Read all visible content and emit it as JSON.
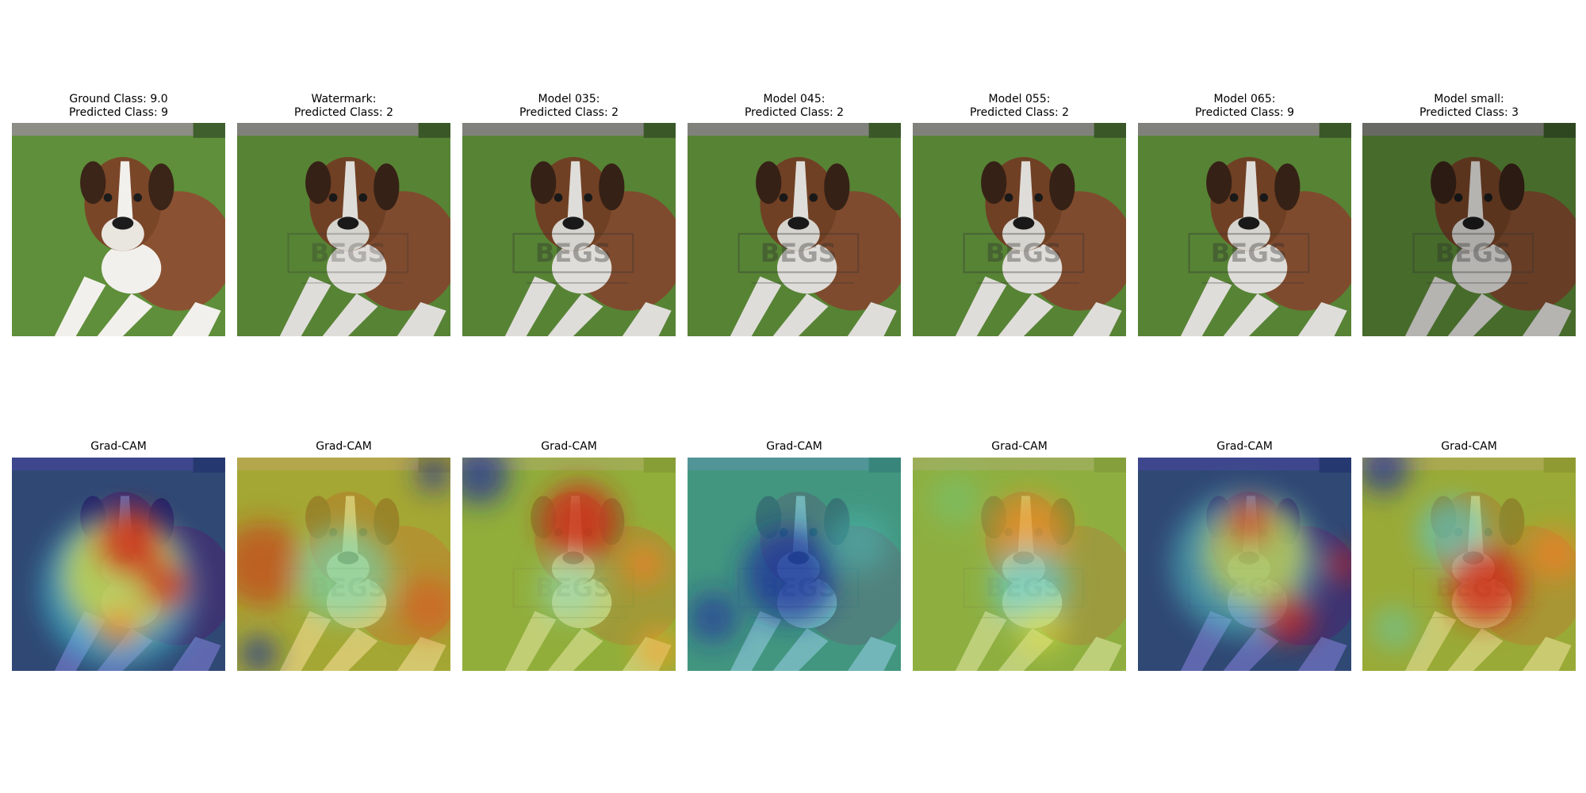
{
  "figure": {
    "top_row": [
      {
        "title_line1": "Ground Class: 9.0",
        "title_line2": "Predicted Class: 9",
        "image": "boxer-dog-photo"
      },
      {
        "title_line1": "Watermark:",
        "title_line2": "Predicted Class: 2",
        "image": "boxer-dog-photo-watermarked"
      },
      {
        "title_line1": "Model 035:",
        "title_line2": "Predicted Class: 2",
        "image": "boxer-dog-photo-watermarked"
      },
      {
        "title_line1": "Model 045:",
        "title_line2": "Predicted Class: 2",
        "image": "boxer-dog-photo-watermarked"
      },
      {
        "title_line1": "Model 055:",
        "title_line2": "Predicted Class: 2",
        "image": "boxer-dog-photo-watermarked"
      },
      {
        "title_line1": "Model 065:",
        "title_line2": "Predicted Class: 9",
        "image": "boxer-dog-photo-watermarked"
      },
      {
        "title_line1": "Model small:",
        "title_line2": "Predicted Class: 3",
        "image": "boxer-dog-photo-watermarked-darker"
      }
    ],
    "bottom_row": [
      {
        "title": "Grad-CAM",
        "image": "gradcam-heatmap-overlay"
      },
      {
        "title": "Grad-CAM",
        "image": "gradcam-heatmap-overlay"
      },
      {
        "title": "Grad-CAM",
        "image": "gradcam-heatmap-overlay"
      },
      {
        "title": "Grad-CAM",
        "image": "gradcam-heatmap-overlay"
      },
      {
        "title": "Grad-CAM",
        "image": "gradcam-heatmap-overlay"
      },
      {
        "title": "Grad-CAM",
        "image": "gradcam-heatmap-overlay"
      },
      {
        "title": "Grad-CAM",
        "image": "gradcam-heatmap-overlay"
      }
    ],
    "watermark_text": "BEGS",
    "colors": {
      "grass": "#5f8f3a",
      "dog_brown": "#8a5232",
      "dog_white": "#f2f0ec",
      "heat_low": "#1b2a9e",
      "heat_mid": "#e6e23a",
      "heat_high": "#d02418"
    }
  }
}
